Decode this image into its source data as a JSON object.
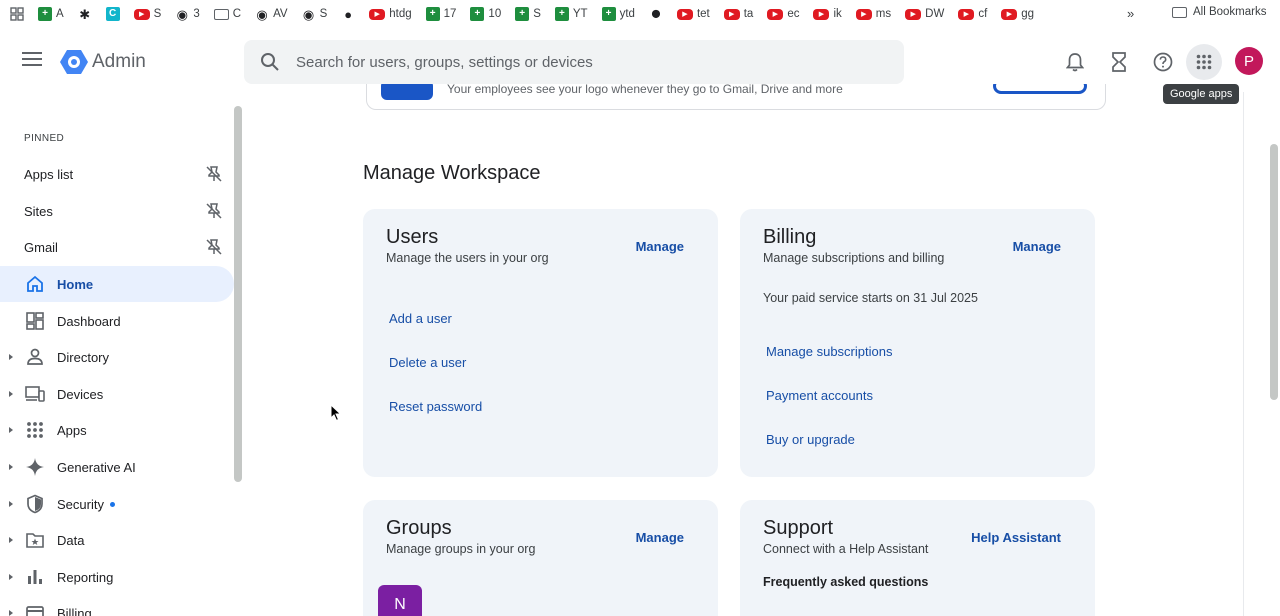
{
  "bookmarks": {
    "items": [
      {
        "label": "A",
        "type": "sheet"
      },
      {
        "label": "",
        "type": "puzzle"
      },
      {
        "label": "",
        "type": "teal"
      },
      {
        "label": "S",
        "type": "yt"
      },
      {
        "label": "3",
        "type": "dark"
      },
      {
        "label": "C",
        "type": "folder"
      },
      {
        "label": "AV",
        "type": "dark"
      },
      {
        "label": "S",
        "type": "dark"
      },
      {
        "label": "",
        "type": "github"
      },
      {
        "label": "htdg",
        "type": "yt"
      },
      {
        "label": "17",
        "type": "sheet"
      },
      {
        "label": "10",
        "type": "sheet"
      },
      {
        "label": "S",
        "type": "sheet"
      },
      {
        "label": "YT",
        "type": "sheet"
      },
      {
        "label": "ytd",
        "type": "sheet"
      },
      {
        "label": "",
        "type": "pin"
      },
      {
        "label": "tet",
        "type": "yt"
      },
      {
        "label": "ta",
        "type": "yt"
      },
      {
        "label": "ec",
        "type": "yt"
      },
      {
        "label": "ik",
        "type": "yt"
      },
      {
        "label": "ms",
        "type": "yt"
      },
      {
        "label": "DW",
        "type": "yt"
      },
      {
        "label": "cf",
        "type": "yt"
      },
      {
        "label": "gg",
        "type": "yt"
      }
    ],
    "more": "»",
    "all_bookmarks": "All Bookmarks"
  },
  "header": {
    "brand": "Admin",
    "search_placeholder": "Search for users, groups, settings or devices",
    "avatar_letter": "P",
    "tooltip": "Google apps"
  },
  "sidebar": {
    "pinned_title": "PINNED",
    "pinned": [
      {
        "label": "Apps list"
      },
      {
        "label": "Sites"
      },
      {
        "label": "Gmail"
      }
    ],
    "nav": [
      {
        "label": "Home",
        "icon": "home-icon",
        "active": true,
        "caret": false
      },
      {
        "label": "Dashboard",
        "icon": "dashboard-icon",
        "active": false,
        "caret": false
      },
      {
        "label": "Directory",
        "icon": "person-icon",
        "active": false,
        "caret": true
      },
      {
        "label": "Devices",
        "icon": "devices-icon",
        "active": false,
        "caret": true
      },
      {
        "label": "Apps",
        "icon": "apps-grid-icon",
        "active": false,
        "caret": true
      },
      {
        "label": "Generative AI",
        "icon": "sparkle-icon",
        "active": false,
        "caret": true
      },
      {
        "label": "Security",
        "icon": "shield-icon",
        "active": false,
        "caret": true
      },
      {
        "label": "Data",
        "icon": "data-folder-icon",
        "active": false,
        "caret": true
      },
      {
        "label": "Reporting",
        "icon": "bar-chart-icon",
        "active": false,
        "caret": true
      },
      {
        "label": "Billing",
        "icon": "billing-icon",
        "active": false,
        "caret": true
      }
    ]
  },
  "main": {
    "banner_text": "Your employees see your logo whenever they go to Gmail, Drive and more",
    "section_title": "Manage Workspace",
    "cards": {
      "users": {
        "title": "Users",
        "subtitle": "Manage the users in your org",
        "action": "Manage",
        "links": [
          "Add a user",
          "Delete a user",
          "Reset password"
        ]
      },
      "billing": {
        "title": "Billing",
        "subtitle": "Manage subscriptions and billing",
        "action": "Manage",
        "note": "Your paid service starts on 31 Jul 2025",
        "links": [
          "Manage subscriptions",
          "Payment accounts",
          "Buy or upgrade"
        ]
      },
      "groups": {
        "title": "Groups",
        "subtitle": "Manage groups in your org",
        "action": "Manage",
        "avatar_letter": "N"
      },
      "support": {
        "title": "Support",
        "subtitle": "Connect with a Help Assistant",
        "action": "Help Assistant",
        "faq_title": "Frequently asked questions"
      }
    }
  },
  "colors": {
    "accent": "#174ea6",
    "active_bg": "#e8f0fe",
    "card_bg": "#f0f4f9",
    "avatar": "#c2185b",
    "group_avatar": "#7b1fa2"
  }
}
